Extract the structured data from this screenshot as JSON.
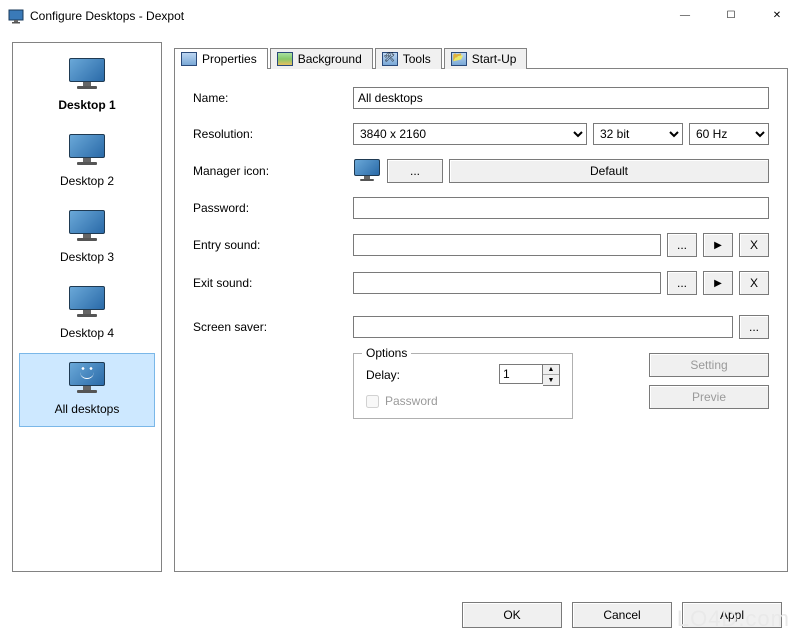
{
  "window": {
    "title": "Configure Desktops - Dexpot",
    "minimize": "—",
    "maximize": "☐",
    "close": "✕"
  },
  "sidebar": {
    "items": [
      {
        "label": "Desktop 1",
        "bold": true,
        "selected": false,
        "smile": false
      },
      {
        "label": "Desktop 2",
        "bold": false,
        "selected": false,
        "smile": false
      },
      {
        "label": "Desktop 3",
        "bold": false,
        "selected": false,
        "smile": false
      },
      {
        "label": "Desktop 4",
        "bold": false,
        "selected": false,
        "smile": false
      },
      {
        "label": "All desktops",
        "bold": false,
        "selected": true,
        "smile": true
      }
    ]
  },
  "tabs": {
    "items": [
      {
        "label": "Properties",
        "active": true
      },
      {
        "label": "Background",
        "active": false
      },
      {
        "label": "Tools",
        "active": false
      },
      {
        "label": "Start-Up",
        "active": false
      }
    ]
  },
  "form": {
    "name_label": "Name:",
    "name_value": "All desktops",
    "resolution_label": "Resolution:",
    "resolution_value": "3840 x 2160",
    "colordepth_value": "32 bit",
    "refresh_value": "60 Hz",
    "manager_icon_label": "Manager icon:",
    "browse_label": "...",
    "default_label": "Default",
    "password_label": "Password:",
    "password_value": "",
    "entry_sound_label": "Entry sound:",
    "entry_sound_value": "",
    "exit_sound_label": "Exit sound:",
    "exit_sound_value": "",
    "play_label": "▶",
    "clear_label": "X",
    "screensaver_label": "Screen saver:",
    "screensaver_value": "",
    "options": {
      "legend": "Options",
      "delay_label": "Delay:",
      "delay_value": "1",
      "password_check_label": "Password"
    },
    "setting_button": "Setting",
    "preview_button": "Previe"
  },
  "buttons": {
    "ok": "OK",
    "cancel": "Cancel",
    "apply": "Appl"
  },
  "watermark": "LO4D.com"
}
